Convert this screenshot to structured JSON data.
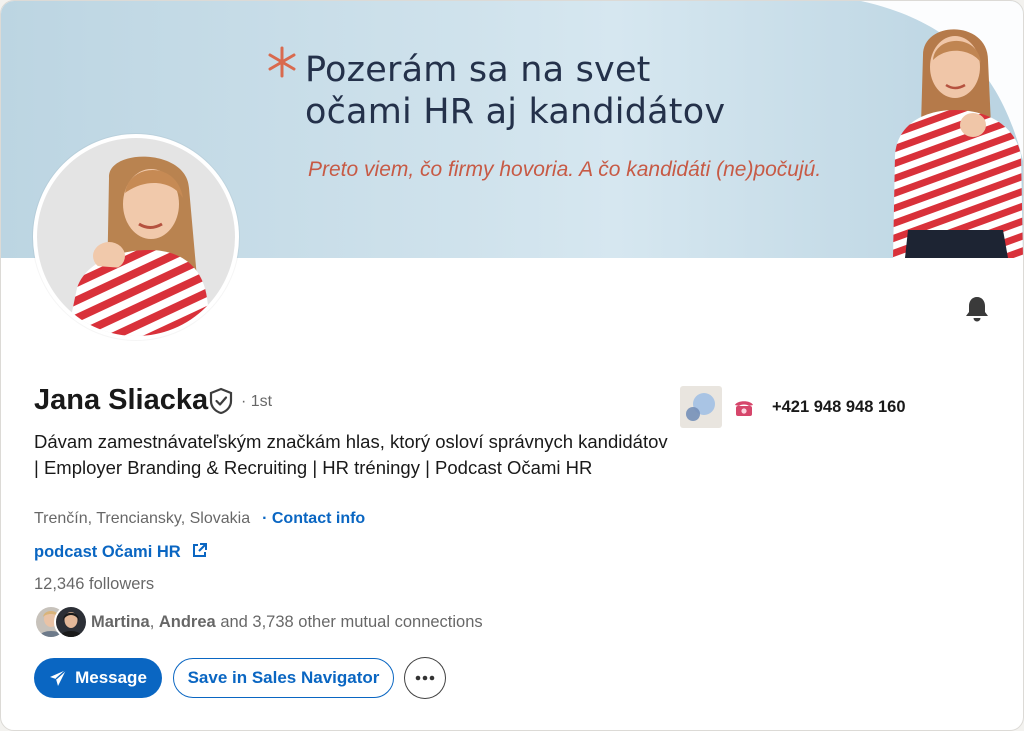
{
  "banner": {
    "headline_line1": "Pozerám sa na svet",
    "headline_line2": "očami HR aj kandidátov",
    "subline": "Preto viem, čo firmy hovoria. A čo kandidáti (ne)počujú."
  },
  "profile": {
    "name": "Jana Sliacka",
    "degree": "· 1st",
    "headline": "Dávam zamestnávateľským značkám hlas, ktorý osloví správnych kandidátov | Employer Branding & Recruiting | HR tréningy | Podcast Očami HR",
    "location": "Trenčín, Trenciansky, Slovakia",
    "contact_info_label": "· Contact info",
    "website_label": "podcast Očami HR",
    "followers": "12,346 followers",
    "mutual": {
      "name1": "Martina",
      "name2": "Andrea",
      "rest": "and 3,738 other mutual connections"
    },
    "phone": "+421 948 948 160"
  },
  "actions": {
    "message_label": "Message",
    "sales_nav_label": "Save in Sales Navigator",
    "more_label": "···"
  },
  "colors": {
    "accent": "#0a66c2",
    "banner_bg": "#cfe2ec",
    "banner_text": "#24314a",
    "banner_sub": "#c75a45",
    "stripe_red": "#d9313a"
  },
  "icons": [
    "star-icon",
    "bell-icon",
    "verified-shield-icon",
    "external-link-icon",
    "send-icon",
    "more-icon",
    "phone-icon",
    "company-logo-icon"
  ]
}
